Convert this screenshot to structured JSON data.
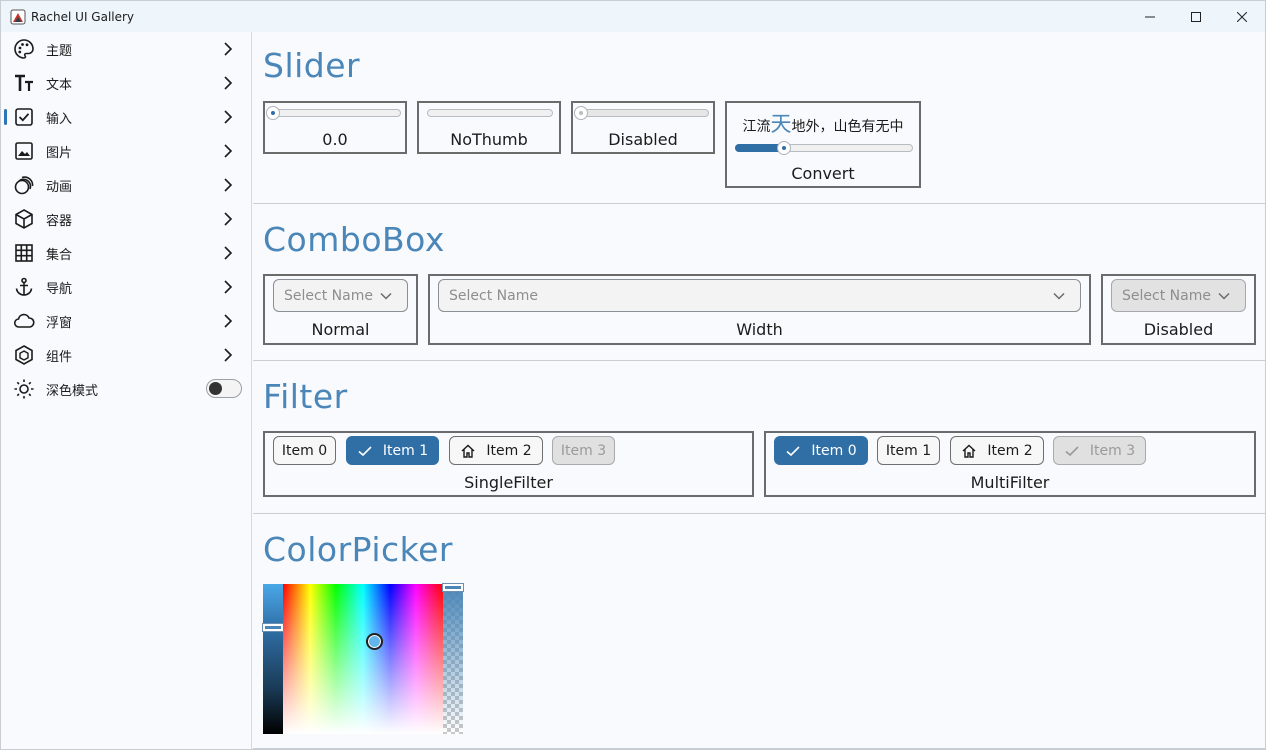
{
  "window": {
    "title": "Rachel UI Gallery",
    "controls": {
      "minimize": "—",
      "maximize": "☐",
      "close": "✕"
    }
  },
  "sidebar": {
    "items": [
      {
        "label": "主题",
        "icon": "palette-icon"
      },
      {
        "label": "文本",
        "icon": "text-icon"
      },
      {
        "label": "输入",
        "icon": "checkbox-icon",
        "active": true
      },
      {
        "label": "图片",
        "icon": "image-icon"
      },
      {
        "label": "动画",
        "icon": "animation-icon"
      },
      {
        "label": "容器",
        "icon": "cube-icon"
      },
      {
        "label": "集合",
        "icon": "grid-icon"
      },
      {
        "label": "导航",
        "icon": "anchor-icon"
      },
      {
        "label": "浮窗",
        "icon": "cloud-icon"
      },
      {
        "label": "组件",
        "icon": "component-icon"
      }
    ],
    "dark_mode": {
      "label": "深色模式",
      "enabled": false
    }
  },
  "sections": {
    "slider": {
      "title": "Slider",
      "items": [
        {
          "label": "0.0",
          "value": 0.0
        },
        {
          "label": "NoThumb"
        },
        {
          "label": "Disabled",
          "value": 0.0
        },
        {
          "label": "Convert",
          "value": 0.27,
          "header_pre": "江流",
          "header_big": "天",
          "header_post": "地外，山色有无中"
        }
      ]
    },
    "combobox": {
      "title": "ComboBox",
      "items": [
        {
          "label": "Normal",
          "placeholder": "Select Name"
        },
        {
          "label": "Width",
          "placeholder": "Select Name"
        },
        {
          "label": "Disabled",
          "placeholder": "Select Name"
        }
      ]
    },
    "filter": {
      "title": "Filter",
      "single": {
        "label": "SingleFilter",
        "chips": [
          {
            "label": "Item 0",
            "state": "normal"
          },
          {
            "label": "Item 1",
            "state": "selected",
            "icon": "check-icon"
          },
          {
            "label": "Item 2",
            "state": "normal",
            "icon": "home-icon"
          },
          {
            "label": "Item 3",
            "state": "disabled"
          }
        ]
      },
      "multi": {
        "label": "MultiFilter",
        "chips": [
          {
            "label": "Item 0",
            "state": "selected",
            "icon": "check-icon"
          },
          {
            "label": "Item 1",
            "state": "normal"
          },
          {
            "label": "Item 2",
            "state": "normal",
            "icon": "home-icon"
          },
          {
            "label": "Item 3",
            "state": "disabled",
            "icon": "check-icon"
          }
        ]
      }
    },
    "colorpicker": {
      "title": "ColorPicker",
      "color": "#62b6ec",
      "accent": "#4a86b8"
    }
  },
  "theme": {
    "accent": "#2f6fa6",
    "title_color": "#4a86b8"
  }
}
